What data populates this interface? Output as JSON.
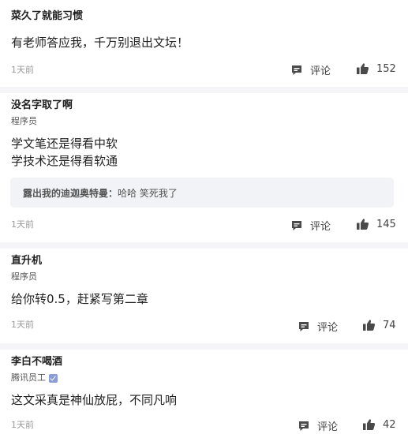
{
  "comments": [
    {
      "author": "菜久了就能习惯",
      "role": "",
      "lines": [
        "有老师答应我，千万别退出文坛！"
      ],
      "reply": null,
      "time": "1天前",
      "comment_label": "评论",
      "likes": "152"
    },
    {
      "author": "没名字取了啊",
      "role": "程序员",
      "lines": [
        "学文笔还是得看中软",
        "学技术还是得看软通"
      ],
      "reply": {
        "author": "露出我的迪迦奥特曼：",
        "text": "哈哈 笑死我了"
      },
      "time": "1天前",
      "comment_label": "评论",
      "likes": "145"
    },
    {
      "author": "直升机",
      "role": "程序员",
      "lines": [
        "给你转0.5，赶紧写第二章"
      ],
      "reply": null,
      "time": "1天前",
      "comment_label": "评论",
      "likes": "74"
    },
    {
      "author": "李白不喝酒",
      "role": "腾讯员工",
      "verified": true,
      "lines": [
        "这文采真是神仙放屁，不同凡响"
      ],
      "reply": null,
      "time": "1天前",
      "comment_label": "评论",
      "likes": "42"
    }
  ],
  "icons": {
    "comment": "comment-bubble-icon",
    "like": "thumbs-up-icon",
    "verified": "verified-badge-icon"
  },
  "colors": {
    "divider": "#f5f5f7",
    "reply_background": "#f2f3f7",
    "icon": "#4a4a4a",
    "verified": "#8a9bd6"
  }
}
